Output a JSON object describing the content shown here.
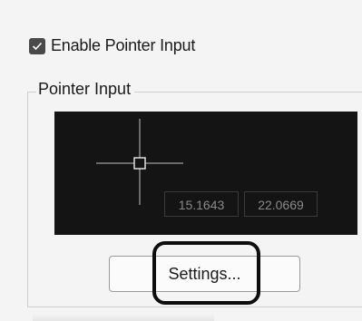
{
  "pointer_input": {
    "enable_label": "Enable Pointer Input",
    "enabled": true,
    "group_title": "Pointer Input",
    "preview": {
      "x_value": "15.1643",
      "y_value": "22.0669"
    },
    "settings_label": "Settings..."
  },
  "icons": {
    "checkbox": "check-icon",
    "cursor": "crosshair-cursor-icon"
  },
  "colors": {
    "preview_background": "#141414",
    "checkbox_fill": "#4a4a4a",
    "highlight_ring": "#0e0e0e"
  }
}
